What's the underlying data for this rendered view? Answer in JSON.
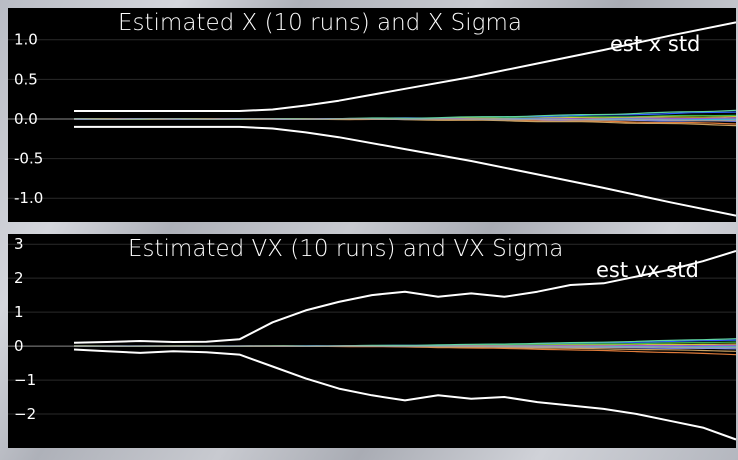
{
  "window": {
    "background": "#c9ccd3"
  },
  "chart_data": [
    {
      "type": "line",
      "title": "Estimated X (10 runs) and X Sigma",
      "legend": [
        "est x std"
      ],
      "legend_placement": "top-right",
      "ylim": [
        -1.3,
        1.4
      ],
      "yticks": [
        "1.0",
        "0.5",
        "0.0",
        "-0.5",
        "-1.0"
      ],
      "ytick_values": [
        1.0,
        0.5,
        0.0,
        -0.5,
        -1.0
      ],
      "grid": true,
      "xlim": [
        0,
        10
      ],
      "sigma_upper": {
        "name": "est x std",
        "x": [
          0,
          1,
          2,
          2.5,
          3,
          3.5,
          4,
          5,
          6,
          7,
          8,
          9,
          10
        ],
        "y": [
          0.1,
          0.1,
          0.1,
          0.1,
          0.12,
          0.17,
          0.23,
          0.38,
          0.53,
          0.7,
          0.87,
          1.05,
          1.22
        ],
        "color": "#ffffff"
      },
      "sigma_lower": {
        "x": [
          0,
          1,
          2,
          2.5,
          3,
          3.5,
          4,
          5,
          6,
          7,
          8,
          9,
          10
        ],
        "y": [
          -0.1,
          -0.1,
          -0.1,
          -0.1,
          -0.12,
          -0.17,
          -0.23,
          -0.38,
          -0.53,
          -0.7,
          -0.87,
          -1.05,
          -1.22
        ],
        "color": "#ffffff"
      },
      "runs": [
        {
          "color": "#2f5cff",
          "end": 0.09
        },
        {
          "color": "#39b54a",
          "end": 0.05
        },
        {
          "color": "#d4c435",
          "end": 0.03
        },
        {
          "color": "#9b59d0",
          "end": 0.01
        },
        {
          "color": "#3fb6d6",
          "end": -0.01
        },
        {
          "color": "#7d8cff",
          "end": -0.03
        },
        {
          "color": "#e07b3a",
          "end": -0.06
        },
        {
          "color": "#c8a060",
          "end": -0.08
        },
        {
          "color": "#5fd3a0",
          "end": 0.11
        },
        {
          "color": "#a0a0a0",
          "end": -0.02
        }
      ]
    },
    {
      "type": "line",
      "title": "Estimated VX (10 runs) and VX Sigma",
      "legend": [
        "est vx std"
      ],
      "legend_placement": "top-right",
      "ylim": [
        -3.0,
        3.3
      ],
      "yticks": [
        "3",
        "2",
        "1",
        "0",
        "−1",
        "−2"
      ],
      "ytick_values": [
        3,
        2,
        1,
        0,
        -1,
        -2
      ],
      "grid": true,
      "xlim": [
        0,
        10
      ],
      "sigma_upper": {
        "name": "est vx std",
        "x": [
          0,
          0.5,
          1,
          1.5,
          2,
          2.5,
          3,
          3.5,
          4,
          4.5,
          5,
          5.5,
          6,
          6.5,
          7,
          7.5,
          8,
          8.5,
          9,
          9.5,
          10
        ],
        "y": [
          0.1,
          0.12,
          0.15,
          0.12,
          0.13,
          0.2,
          0.7,
          1.05,
          1.3,
          1.5,
          1.6,
          1.45,
          1.55,
          1.45,
          1.6,
          1.8,
          1.85,
          2.05,
          2.25,
          2.5,
          2.8
        ],
        "color": "#ffffff"
      },
      "sigma_lower": {
        "x": [
          0,
          0.5,
          1,
          1.5,
          2,
          2.5,
          3,
          3.5,
          4,
          4.5,
          5,
          5.5,
          6,
          6.5,
          7,
          7.5,
          8,
          8.5,
          9,
          9.5,
          10
        ],
        "y": [
          -0.1,
          -0.15,
          -0.2,
          -0.15,
          -0.18,
          -0.25,
          -0.6,
          -0.95,
          -1.25,
          -1.45,
          -1.6,
          -1.45,
          -1.55,
          -1.5,
          -1.65,
          -1.75,
          -1.85,
          -2.0,
          -2.2,
          -2.4,
          -2.75
        ],
        "color": "#ffffff"
      },
      "runs": [
        {
          "color": "#2f5cff",
          "end": 0.18
        },
        {
          "color": "#39b54a",
          "end": 0.12
        },
        {
          "color": "#d4c435",
          "end": 0.06
        },
        {
          "color": "#9b59d0",
          "end": 0.02
        },
        {
          "color": "#3fb6d6",
          "end": -0.03
        },
        {
          "color": "#7d8cff",
          "end": -0.08
        },
        {
          "color": "#e07b3a",
          "end": -0.25
        },
        {
          "color": "#c8a060",
          "end": -0.15
        },
        {
          "color": "#5fd3a0",
          "end": 0.22
        },
        {
          "color": "#a0a0a0",
          "end": -0.05
        }
      ]
    }
  ]
}
